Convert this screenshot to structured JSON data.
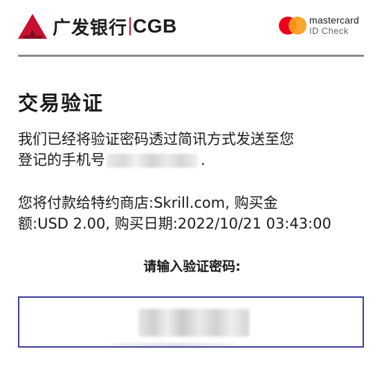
{
  "header": {
    "bank_name": "广发银行",
    "bank_latin": "CGB",
    "card_network": {
      "brand": "mastercard",
      "product": "ID Check",
      "colors": {
        "red": "#eb001b",
        "yellow": "#f79e1b"
      }
    },
    "bank_brand_color": "#c8102e"
  },
  "main": {
    "title": "交易验证",
    "message_line1": "我们已经将验证密码透过简讯方式发送至您",
    "message_line2_prefix": "登记的手机号",
    "message_line2_suffix": ".",
    "detail_line1": "您将付款给特约商店:Skrill.com, 购买金",
    "detail_line2": "额:USD 2.00, 购买日期:2022/10/21 03:43:00",
    "code_label": "请输入验证密码:"
  },
  "input": {
    "placeholder": "",
    "border_color": "#3b3b9a"
  }
}
